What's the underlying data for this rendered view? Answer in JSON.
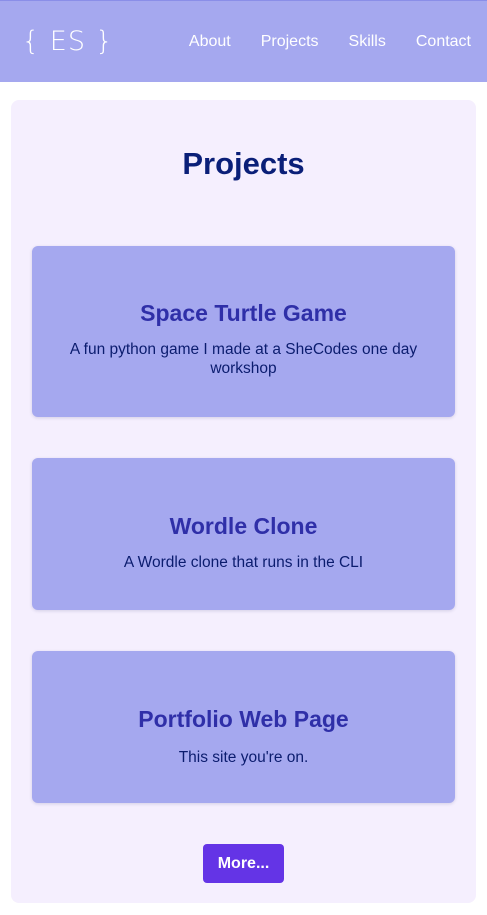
{
  "header": {
    "logo": "{ ES }",
    "nav": [
      {
        "label": "About"
      },
      {
        "label": "Projects"
      },
      {
        "label": "Skills"
      },
      {
        "label": "Contact"
      }
    ]
  },
  "projects": {
    "title": "Projects",
    "items": [
      {
        "title": "Space Turtle Game",
        "description": "A fun python game I made at a SheCodes one day workshop"
      },
      {
        "title": "Wordle Clone",
        "description": "A Wordle clone that runs in the CLI"
      },
      {
        "title": "Portfolio Web Page",
        "description": "This site you're on."
      }
    ],
    "more_label": "More..."
  },
  "colors": {
    "nav_background": "#a5a8ef",
    "panel_background": "#f5effe",
    "card_background": "#a5a8ef",
    "title_color": "#0a1f78",
    "card_title_color": "#2f2fa8",
    "button_color": "#6434e6"
  }
}
